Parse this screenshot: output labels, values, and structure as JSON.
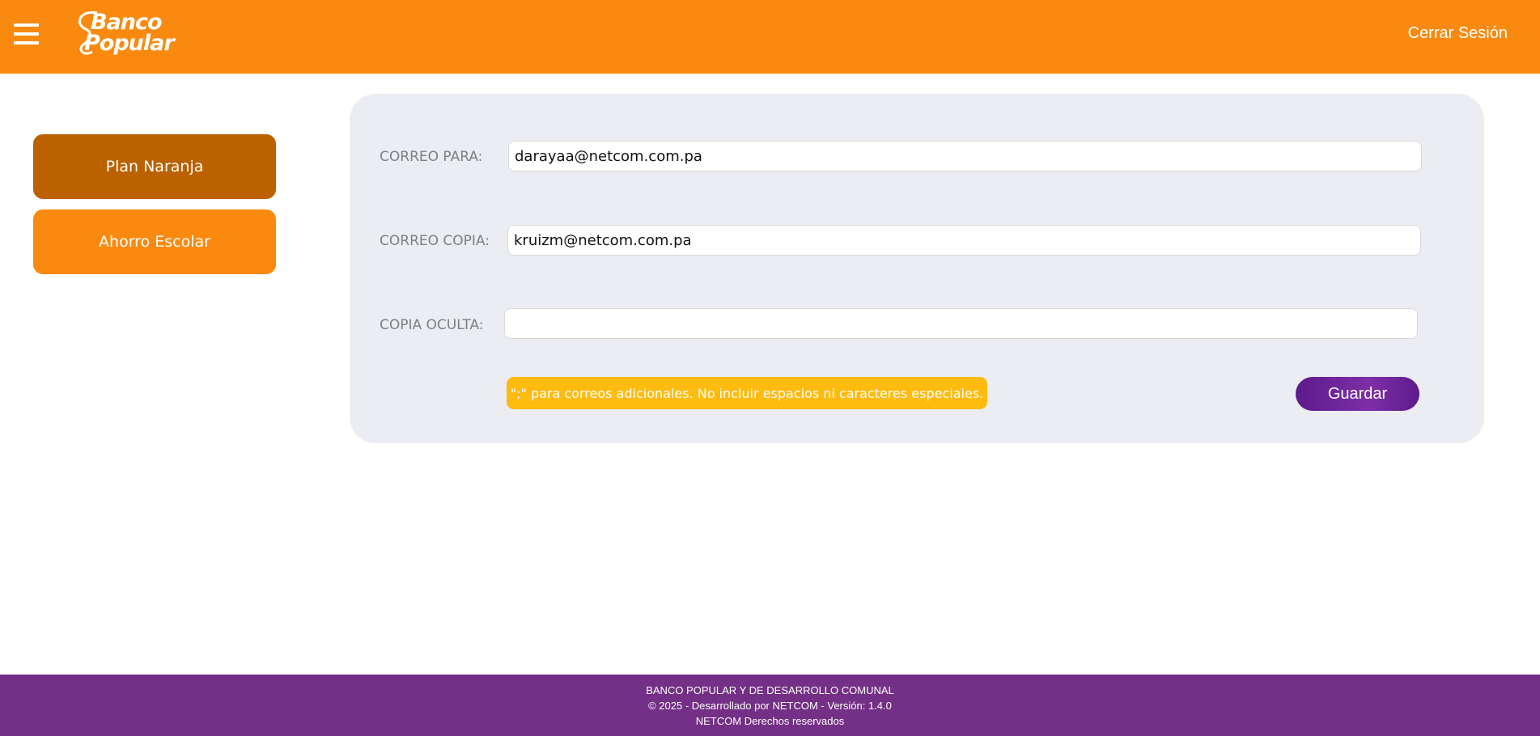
{
  "header": {
    "brand_line1": "Banco",
    "brand_line2": "Popular",
    "logout_label": "Cerrar Sesión",
    "menu_icon": "hamburger-menu-icon",
    "background_color": "#f98a0f"
  },
  "sidebar": {
    "items": [
      {
        "label": "Plan Naranja",
        "active": true
      },
      {
        "label": "Ahorro Escolar",
        "active": false
      }
    ],
    "active_color": "#bb6100",
    "item_color": "#f98a0f"
  },
  "form": {
    "to_label": "CORREO PARA:",
    "to_value": "darayaa@netcom.com.pa",
    "cc_label": "CORREO COPIA:",
    "cc_value": "kruizm@netcom.com.pa",
    "bcc_label": "COPIA OCULTA:",
    "bcc_value": "",
    "hint": "\";\" para correos adicionales. No incluir espacios ni caracteres especiales.",
    "save_label": "Guardar",
    "hint_color": "#ffbb0e",
    "save_color": "#6a2196"
  },
  "footer": {
    "line1": "BANCO POPULAR Y DE DESARROLLO COMUNAL",
    "line2": "© 2025 - Desarrollado por NETCOM - Versión: 1.4.0",
    "line3": "NETCOM Derechos reservados",
    "background_color": "#742f86"
  }
}
